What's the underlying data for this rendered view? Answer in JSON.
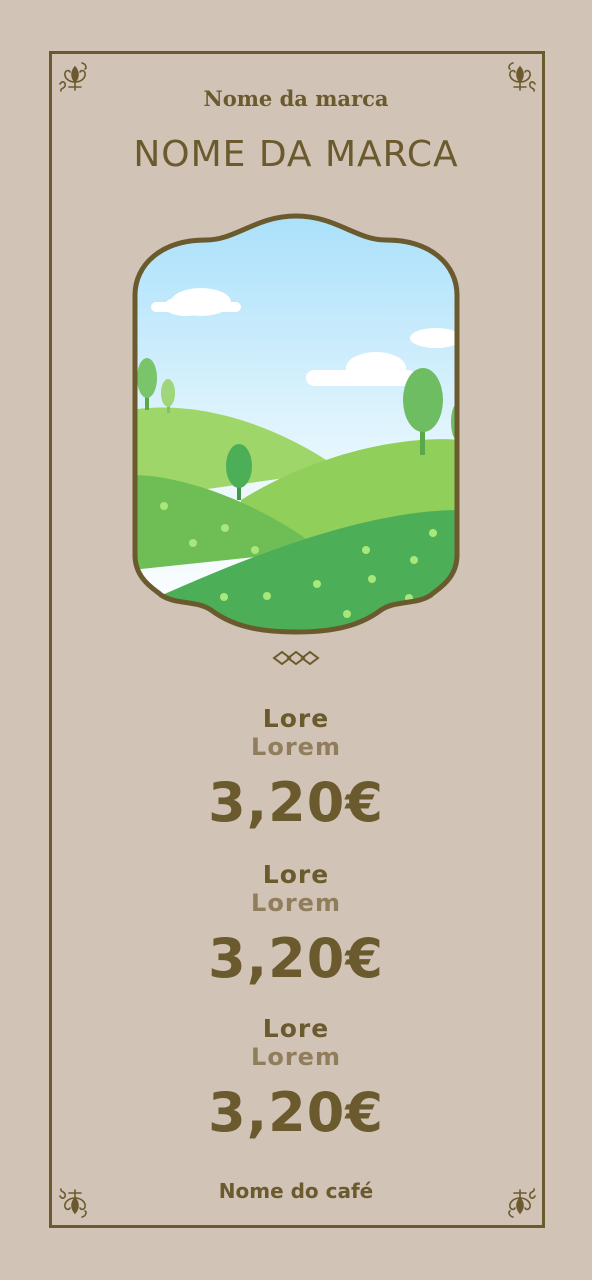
{
  "colors": {
    "background": "#d1c4b6",
    "accent": "#6b5a2e",
    "subtle": "#8f7d5c"
  },
  "header": {
    "brand_small": "Nome da marca",
    "brand_big": "NOME DA MARCA"
  },
  "illustration": {
    "name": "landscape-hills-illustration"
  },
  "menu": {
    "items": [
      {
        "title": "Lore",
        "subtitle": "Lorem",
        "price": "3,20€"
      },
      {
        "title": "Lore",
        "subtitle": "Lorem",
        "price": "3,20€"
      },
      {
        "title": "Lore",
        "subtitle": "Lorem",
        "price": "3,20€"
      }
    ]
  },
  "footer": {
    "cafe_name": "Nome do café"
  },
  "icons": {
    "corner": "fleur-de-lis-corner-icon",
    "divider": "diamond-divider-icon"
  }
}
